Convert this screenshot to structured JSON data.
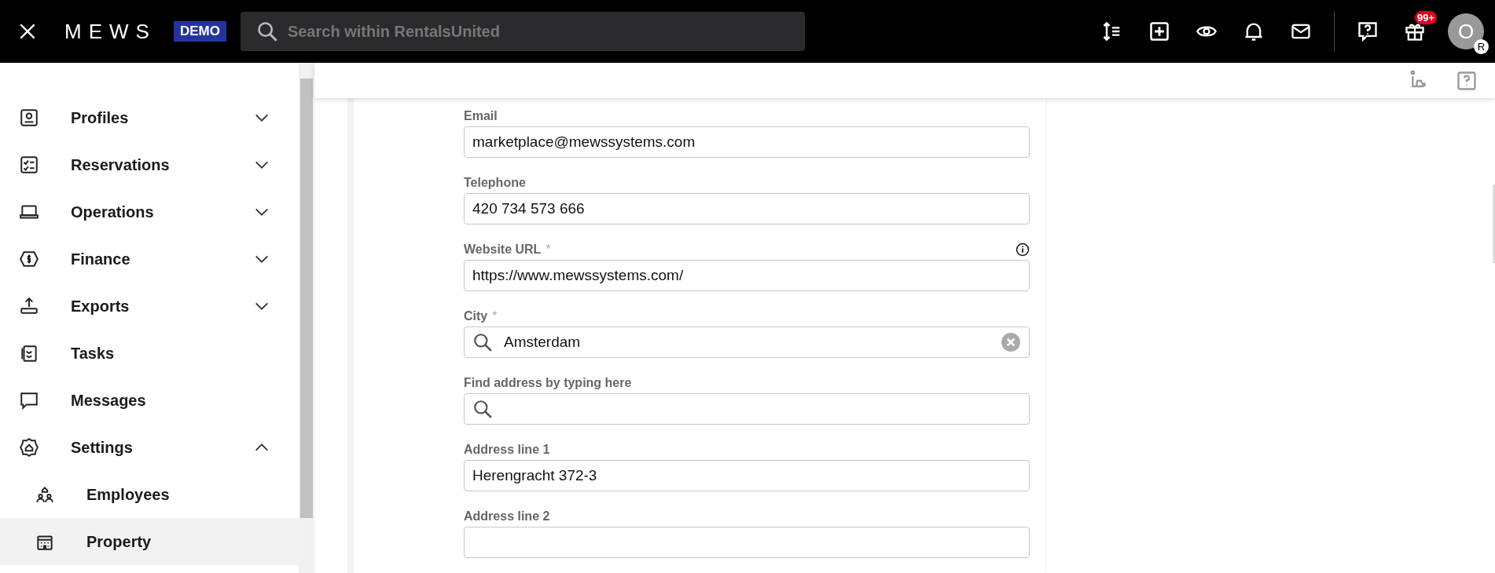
{
  "header": {
    "logo": "MEWS",
    "badge": "DEMO",
    "search": {
      "placeholder": "Search within RentalsUnited"
    },
    "notification_count": "99+",
    "avatar": {
      "initial": "O",
      "sub_initial": "R"
    }
  },
  "sidebar": {
    "items": [
      {
        "label": "Profiles",
        "kind": "group",
        "expanded": false,
        "selected": false
      },
      {
        "label": "Reservations",
        "kind": "group",
        "expanded": false,
        "selected": false
      },
      {
        "label": "Operations",
        "kind": "group",
        "expanded": false,
        "selected": false
      },
      {
        "label": "Finance",
        "kind": "group",
        "expanded": false,
        "selected": false
      },
      {
        "label": "Exports",
        "kind": "group",
        "expanded": false,
        "selected": false
      },
      {
        "label": "Tasks",
        "kind": "link",
        "selected": false
      },
      {
        "label": "Messages",
        "kind": "link",
        "selected": false
      },
      {
        "label": "Settings",
        "kind": "group",
        "expanded": true,
        "selected": false,
        "children": [
          {
            "label": "Employees",
            "selected": false
          },
          {
            "label": "Property",
            "selected": true
          }
        ]
      }
    ]
  },
  "form": {
    "fields": [
      {
        "label": "Email",
        "kind": "text",
        "value": "marketplace@mewssystems.com"
      },
      {
        "label": "Telephone",
        "kind": "text",
        "value": "420 734 573 666"
      },
      {
        "label": "Website URL",
        "required_mark": "*",
        "info": true,
        "kind": "text",
        "value": "https://www.mewssystems.com/"
      },
      {
        "label": "City",
        "required_mark": "*",
        "kind": "search",
        "value": "Amsterdam",
        "clearable": true
      },
      {
        "label": "Find address by typing here",
        "kind": "search"
      },
      {
        "label": "Address line 1",
        "kind": "text",
        "value": "Herengracht 372-3"
      },
      {
        "label": "Address line 2",
        "kind": "text"
      }
    ]
  }
}
